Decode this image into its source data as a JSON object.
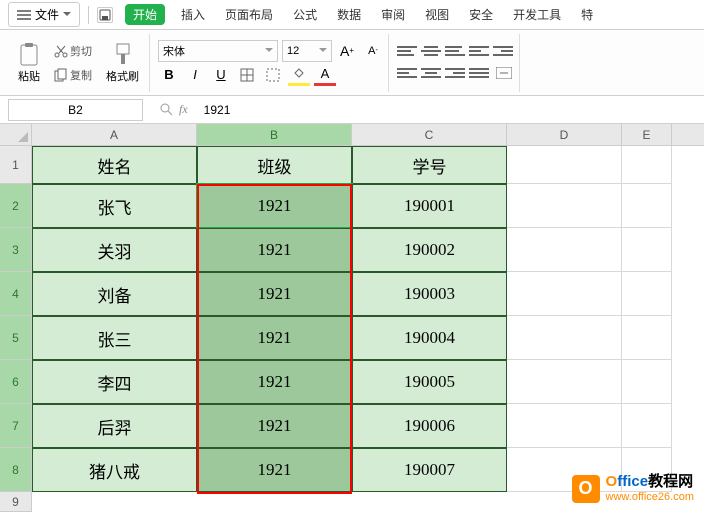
{
  "menubar": {
    "menu_label": "文件",
    "tabs": [
      "开始",
      "插入",
      "页面布局",
      "公式",
      "数据",
      "审阅",
      "视图",
      "安全",
      "开发工具",
      "特"
    ]
  },
  "toolbar": {
    "paste_label": "粘贴",
    "cut_label": "剪切",
    "copy_label": "复制",
    "format_painter_label": "格式刷",
    "font_name": "宋体",
    "font_size": "12",
    "bold": "B",
    "italic": "I",
    "underline": "U",
    "strike_a1": "A",
    "strike_a2": "A",
    "fill_a": "A",
    "font_color_a": "A"
  },
  "formula_bar": {
    "cell_ref": "B2",
    "fx_label": "fx",
    "formula_value": "1921"
  },
  "columns": [
    "A",
    "B",
    "C",
    "D",
    "E"
  ],
  "rows": [
    "1",
    "2",
    "3",
    "4",
    "5",
    "6",
    "7",
    "8",
    "9"
  ],
  "headers": {
    "a": "姓名",
    "b": "班级",
    "c": "学号"
  },
  "data": [
    {
      "a": "张飞",
      "b": "1921",
      "c": "190001"
    },
    {
      "a": "关羽",
      "b": "1921",
      "c": "190002"
    },
    {
      "a": "刘备",
      "b": "1921",
      "c": "190003"
    },
    {
      "a": "张三",
      "b": "1921",
      "c": "190004"
    },
    {
      "a": "李四",
      "b": "1921",
      "c": "190005"
    },
    {
      "a": "后羿",
      "b": "1921",
      "c": "190006"
    },
    {
      "a": "猪八戒",
      "b": "1921",
      "c": "190007"
    }
  ],
  "watermark": {
    "icon": "O",
    "title_o": "O",
    "title_ffice": "ffice",
    "title_suffix": "教程网",
    "url": "www.office26.com"
  }
}
